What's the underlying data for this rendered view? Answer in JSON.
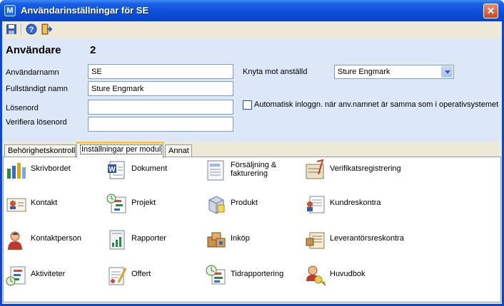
{
  "window": {
    "title": "Användarinställningar för SE",
    "app_icon_letter": "M",
    "close_glyph": "✕"
  },
  "toolbar": {
    "buttons": [
      {
        "name": "save-icon"
      },
      {
        "name": "help-icon"
      },
      {
        "name": "exit-icon"
      }
    ]
  },
  "user": {
    "heading": "Användare",
    "id": "2"
  },
  "fields": {
    "username_label": "Användarnamn",
    "username_value": "SE",
    "fullname_label": "Fullständigt namn",
    "fullname_value": "Sture Engmark",
    "password_label": "Lösenord",
    "password_value": "",
    "verify_label": "Verifiera lösenord",
    "verify_value": "",
    "employee_label": "Knyta mot anställd",
    "employee_value": "Sture Engmark",
    "autologin_label": "Automatisk inloggn. när anv.namnet är samma som i operativsystemet",
    "autologin_checked": false
  },
  "tabs": [
    {
      "label": "Behörighetskontroll",
      "active": false
    },
    {
      "label": "Inställningar per modul",
      "active": true
    },
    {
      "label": "Annat",
      "active": false
    }
  ],
  "modules": [
    {
      "label": "Skrivbordet",
      "icon": "desktop-icon"
    },
    {
      "label": "Dokument",
      "icon": "document-icon"
    },
    {
      "label": "Försäljning &\nfakturering",
      "icon": "invoice-icon"
    },
    {
      "label": "Verifikatsregistrering",
      "icon": "voucher-icon"
    },
    {
      "label": "Kontakt",
      "icon": "contact-card-icon"
    },
    {
      "label": "Projekt",
      "icon": "project-icon"
    },
    {
      "label": "Produkt",
      "icon": "product-icon"
    },
    {
      "label": "Kundreskontra",
      "icon": "customer-ledger-icon"
    },
    {
      "label": "Kontaktperson",
      "icon": "contact-person-icon"
    },
    {
      "label": "Rapporter",
      "icon": "reports-icon"
    },
    {
      "label": "Inköp",
      "icon": "purchase-icon"
    },
    {
      "label": "Leverantörsreskontra",
      "icon": "supplier-ledger-icon"
    },
    {
      "label": "Aktiviteter",
      "icon": "activities-icon"
    },
    {
      "label": "Offert",
      "icon": "quote-icon"
    },
    {
      "label": "Tidrapportering",
      "icon": "time-report-icon"
    },
    {
      "label": "Huvudbok",
      "icon": "general-ledger-icon"
    }
  ]
}
